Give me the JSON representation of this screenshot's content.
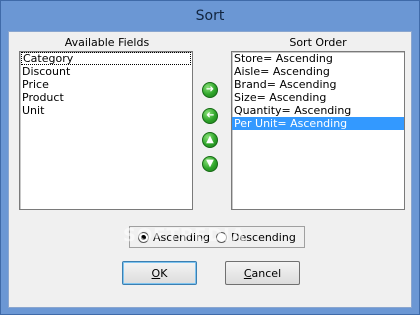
{
  "window": {
    "title": "Sort"
  },
  "available": {
    "label": "Available Fields",
    "items": [
      "Category",
      "Discount",
      "Price",
      "Product",
      "Unit"
    ]
  },
  "order": {
    "label": "Sort Order",
    "items": [
      "Store= Ascending",
      "Aisle= Ascending",
      "Brand= Ascending",
      "Size= Ascending",
      "Quantity= Ascending",
      "Per Unit= Ascending"
    ]
  },
  "direction": {
    "ascending_label": "Ascending",
    "descending_label": "Descending",
    "selected": "Ascending"
  },
  "watermark": "SOFTPEDIA",
  "buttons": {
    "ok": "OK",
    "cancel": "Cancel"
  },
  "colors": {
    "selection": "#3399ff",
    "arrow": "#2fa52a",
    "frame": "#6b97d4"
  }
}
